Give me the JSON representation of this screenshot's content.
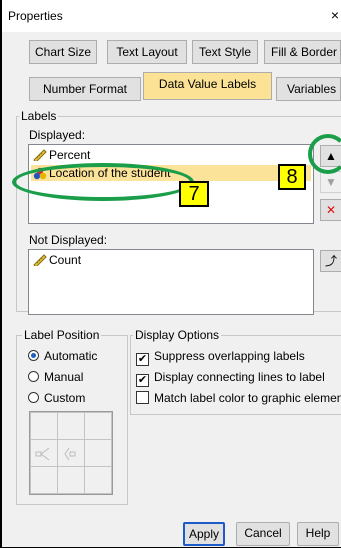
{
  "window": {
    "title": "Properties",
    "close_glyph": "×"
  },
  "tabs_row1": [
    "Chart Size",
    "Text Layout",
    "Text Style",
    "Fill & Border"
  ],
  "tabs_row2": [
    "Number Format",
    "Data Value Labels",
    "Variables"
  ],
  "labels_group": {
    "title": "Labels",
    "displayed_label": "Displayed:",
    "displayed_items": [
      {
        "label": "Percent",
        "icon": "ruler-icon"
      },
      {
        "label": "Location of the student",
        "icon": "nominal-dots-icon"
      }
    ],
    "not_displayed_label": "Not Displayed:",
    "not_displayed_items": [
      {
        "label": "Count",
        "icon": "ruler-icon"
      }
    ]
  },
  "side_buttons": {
    "up": "▲",
    "down": "▼",
    "delete": "✕",
    "move": "⤴"
  },
  "label_position": {
    "title": "Label Position",
    "options": [
      "Automatic",
      "Manual",
      "Custom"
    ],
    "selected": "Automatic"
  },
  "display_options": {
    "title": "Display Options",
    "options": [
      {
        "label": "Suppress overlapping labels",
        "checked": true
      },
      {
        "label": "Display connecting lines to label",
        "checked": true
      },
      {
        "label": "Match label color to graphic element",
        "checked": false
      }
    ]
  },
  "buttons": {
    "apply": "Apply",
    "cancel": "Cancel",
    "help": "Help"
  },
  "annotations": [
    "7",
    "8"
  ],
  "colors": {
    "accent_tab": "#fbe295",
    "annotation_green": "#1a9e4a",
    "annotation_yellow": "#ffff00"
  }
}
